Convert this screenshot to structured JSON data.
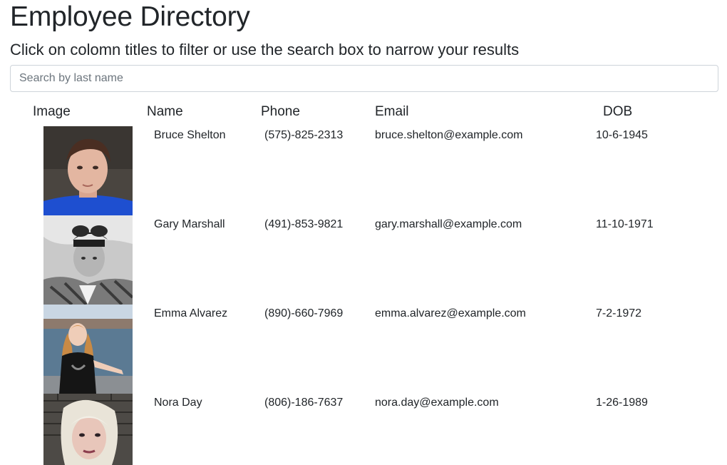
{
  "header": {
    "title": "Employee Directory",
    "subtitle": "Click on colomn titles to filter or use the search box to narrow your results"
  },
  "search": {
    "placeholder": "Search by last name",
    "value": ""
  },
  "table": {
    "columns": {
      "image": "Image",
      "name": "Name",
      "phone": "Phone",
      "email": "Email",
      "dob": "DOB"
    },
    "rows": [
      {
        "name": "Bruce Shelton",
        "phone": "(575)-825-2313",
        "email": "bruce.shelton@example.com",
        "dob": "10-6-1945"
      },
      {
        "name": "Gary Marshall",
        "phone": "(491)-853-9821",
        "email": "gary.marshall@example.com",
        "dob": "11-10-1971"
      },
      {
        "name": "Emma Alvarez",
        "phone": "(890)-660-7969",
        "email": "emma.alvarez@example.com",
        "dob": "7-2-1972"
      },
      {
        "name": "Nora Day",
        "phone": "(806)-186-7637",
        "email": "nora.day@example.com",
        "dob": "1-26-1989"
      }
    ]
  }
}
